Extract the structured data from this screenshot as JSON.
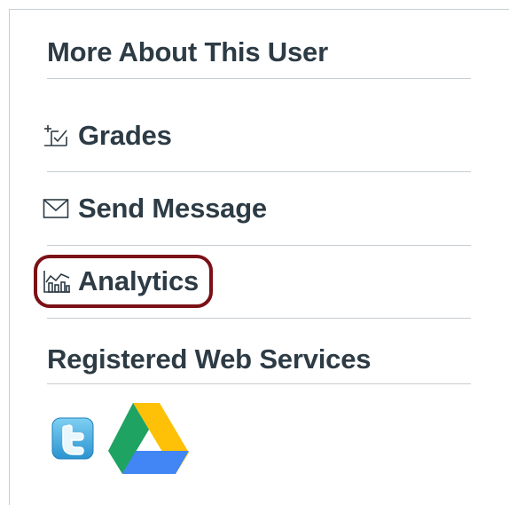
{
  "section_title": "More About This User",
  "links": [
    {
      "label": "Grades",
      "icon": "grades-icon"
    },
    {
      "label": "Send Message",
      "icon": "envelope-icon"
    },
    {
      "label": "Analytics",
      "icon": "analytics-icon"
    }
  ],
  "services_title": "Registered Web Services",
  "services": [
    {
      "name": "twitter",
      "icon": "twitter-icon"
    },
    {
      "name": "google-drive",
      "icon": "google-drive-icon"
    }
  ],
  "colors": {
    "text": "#2d3b45",
    "divider": "#c7cdd1",
    "highlight": "#7b1016",
    "twitter": "#3fa9dc",
    "drive_green": "#1ea362",
    "drive_yellow": "#ffc107",
    "drive_blue": "#4285f4"
  }
}
